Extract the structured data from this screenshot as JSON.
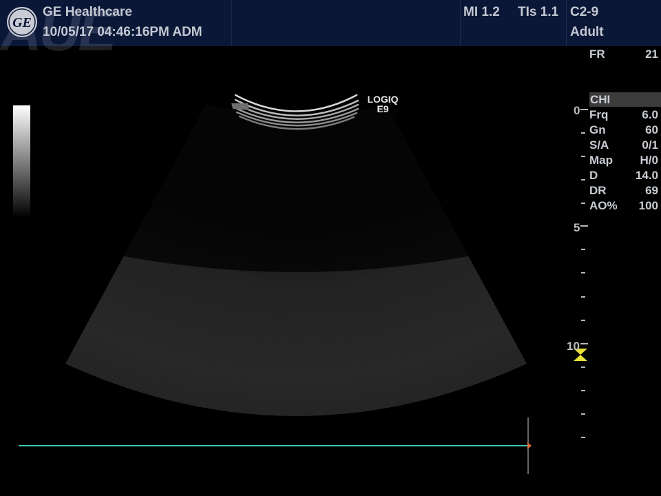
{
  "header": {
    "company": "GE Healthcare",
    "datetime_operator": "10/05/17 04:46:16PM  ADM",
    "mi": "MI 1.2",
    "tis": "TIs 1.1",
    "probe": "C2-9",
    "preset": "Adult",
    "watermark": "AUE",
    "logo_text": "GE"
  },
  "probe_label": {
    "line1": "LOGIQ",
    "line2": "E9"
  },
  "frame_rate": {
    "label": "FR",
    "value": "21"
  },
  "mode": "CHI",
  "params": [
    {
      "key": "Frq",
      "value": "6.0"
    },
    {
      "key": "Gn",
      "value": "60"
    },
    {
      "key": "S/A",
      "value": "0/1"
    },
    {
      "key": "Map",
      "value": "H/0"
    },
    {
      "key": "D",
      "value": "14.0"
    },
    {
      "key": "DR",
      "value": "69"
    },
    {
      "key": "AO%",
      "value": "100"
    }
  ],
  "depth_scale": {
    "labels": [
      "0",
      "5",
      "10"
    ]
  },
  "colors": {
    "header_bg": "#0b1736",
    "text": "#c8ccd3",
    "focus_marker": "#e8e03a",
    "timeline": "#3fc4b0",
    "cursor_marker": "#e06a3a"
  }
}
